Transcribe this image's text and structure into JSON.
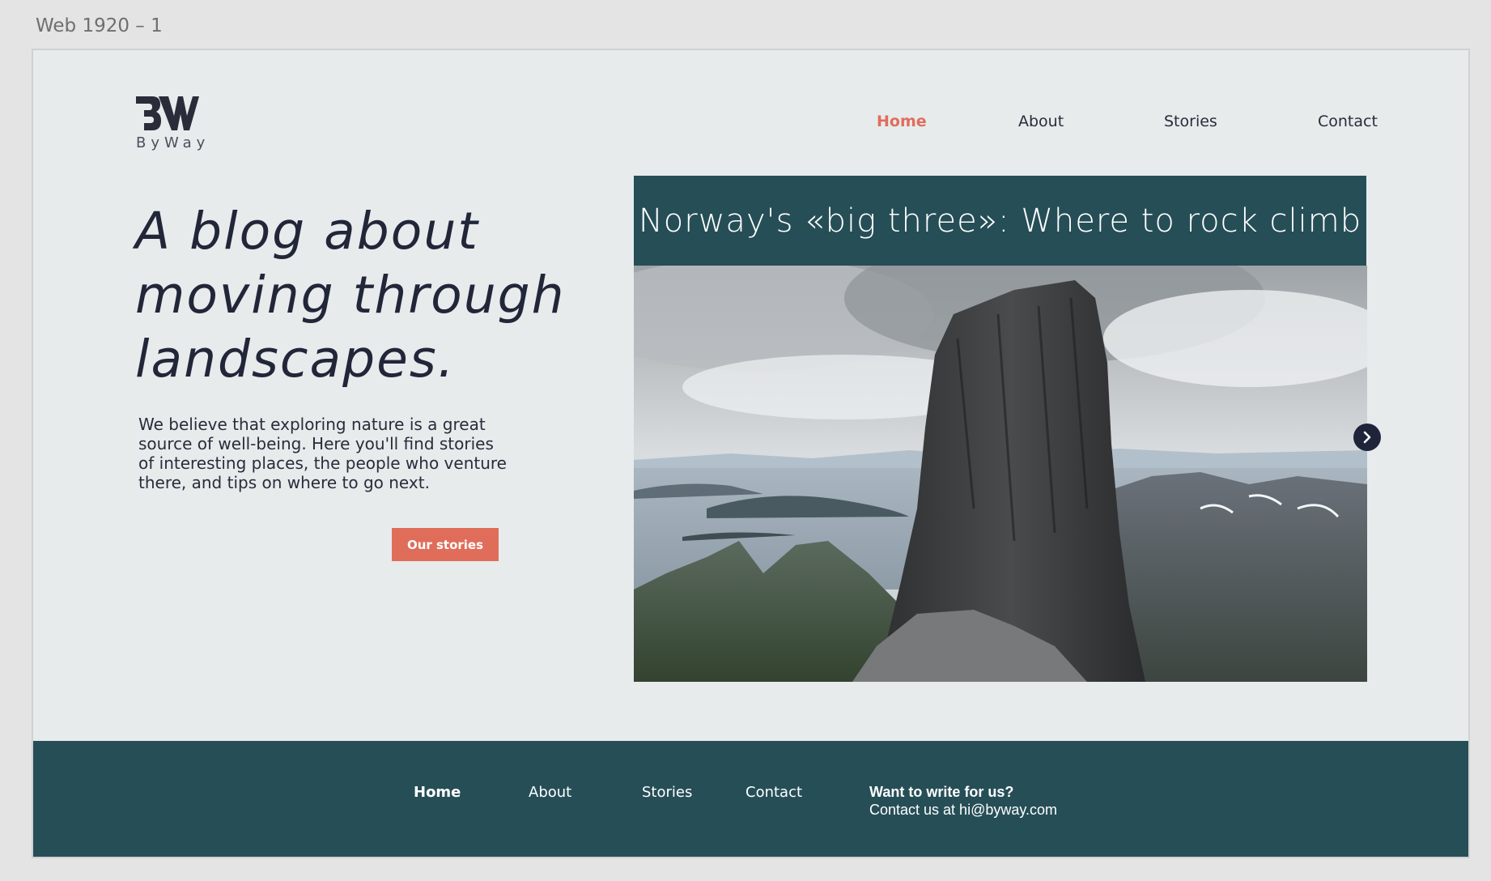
{
  "artboard": {
    "label": "Web 1920 – 1"
  },
  "brand": {
    "name": "ByWay",
    "color_dark": "#2a2c3a"
  },
  "colors": {
    "accent": "#e06d5a",
    "teal": "#264e57",
    "background": "#e7ebec"
  },
  "nav": {
    "items": [
      {
        "label": "Home",
        "active": true
      },
      {
        "label": "About",
        "active": false
      },
      {
        "label": "Stories",
        "active": false
      },
      {
        "label": "Contact",
        "active": false
      }
    ]
  },
  "hero": {
    "title": "A blog about moving through landscapes.",
    "description": "We believe that exploring nature is a great source of well-being. Here you'll find stories of interesting places, the people who venture there, and tips on where to go next.",
    "cta_label": "Our stories"
  },
  "featured": {
    "title": "Norway's  «big three»: Where to rock climb",
    "next_icon": "chevron-right-icon"
  },
  "footer": {
    "nav": [
      {
        "label": "Home",
        "active": true
      },
      {
        "label": "About",
        "active": false
      },
      {
        "label": "Stories",
        "active": false
      },
      {
        "label": "Contact",
        "active": false
      }
    ],
    "write_heading": "Want to write for us?",
    "write_contact": "Contact us at hi@byway.com"
  }
}
